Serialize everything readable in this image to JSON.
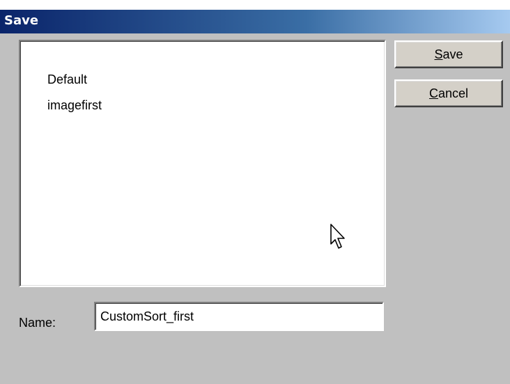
{
  "window": {
    "title": "Save"
  },
  "list": {
    "items": [
      "Default",
      "imagefirst"
    ]
  },
  "buttons": {
    "save_accel": "S",
    "save_rest": "ave",
    "cancel_accel": "C",
    "cancel_rest": "ancel"
  },
  "name_field": {
    "label": "Name:",
    "value": "CustomSort_first"
  },
  "icons": {
    "pointer": "arrow-cursor-icon"
  },
  "colors": {
    "dialog_bg": "#c0c0c0",
    "title_start": "#0a246a",
    "title_end": "#a6caf0"
  }
}
